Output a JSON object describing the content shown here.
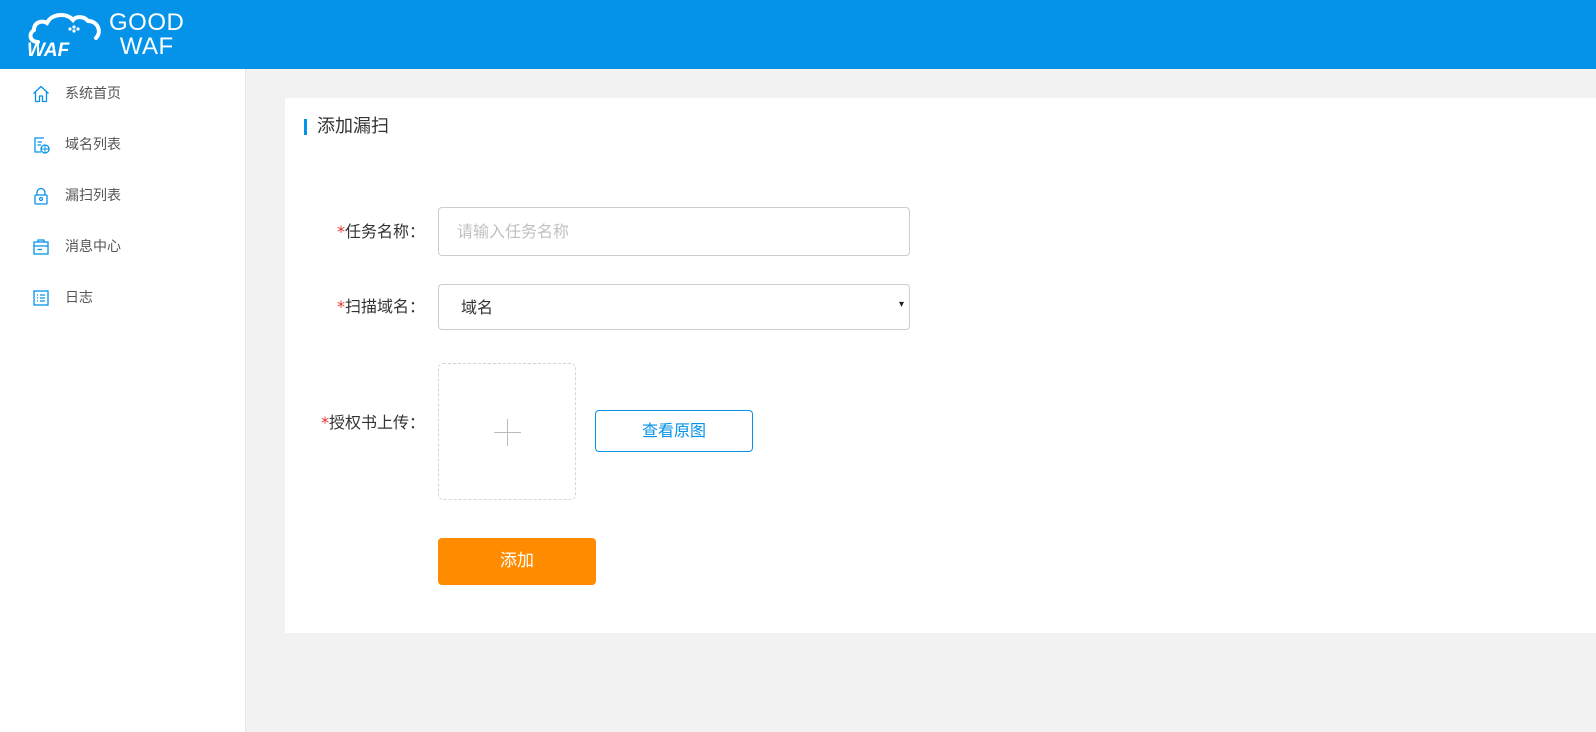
{
  "header": {
    "logo_mark_text": "WAF",
    "logo_line1": "GOOD",
    "logo_line2": "WAF",
    "bg_color": "#0593ea"
  },
  "sidebar": {
    "items": [
      {
        "label": "系统首页",
        "icon": "home-icon"
      },
      {
        "label": "域名列表",
        "icon": "domain-list-icon"
      },
      {
        "label": "漏扫列表",
        "icon": "lock-icon"
      },
      {
        "label": "消息中心",
        "icon": "message-icon"
      },
      {
        "label": "日志",
        "icon": "log-icon"
      }
    ]
  },
  "form": {
    "title": "添加漏扫",
    "required_mark": "*",
    "task_name": {
      "label": "任务名称：",
      "placeholder": "请输入任务名称",
      "value": ""
    },
    "scan_domain": {
      "label": "扫描域名：",
      "value": "域名",
      "caret": "▾"
    },
    "auth_upload": {
      "label": "授权书上传：",
      "upload_icon": "plus-icon"
    },
    "view_original_label": "查看原图",
    "submit_label": "添加"
  },
  "colors": {
    "accent": "#0593ea",
    "submit": "#ff8c00",
    "required": "#e8342e"
  }
}
